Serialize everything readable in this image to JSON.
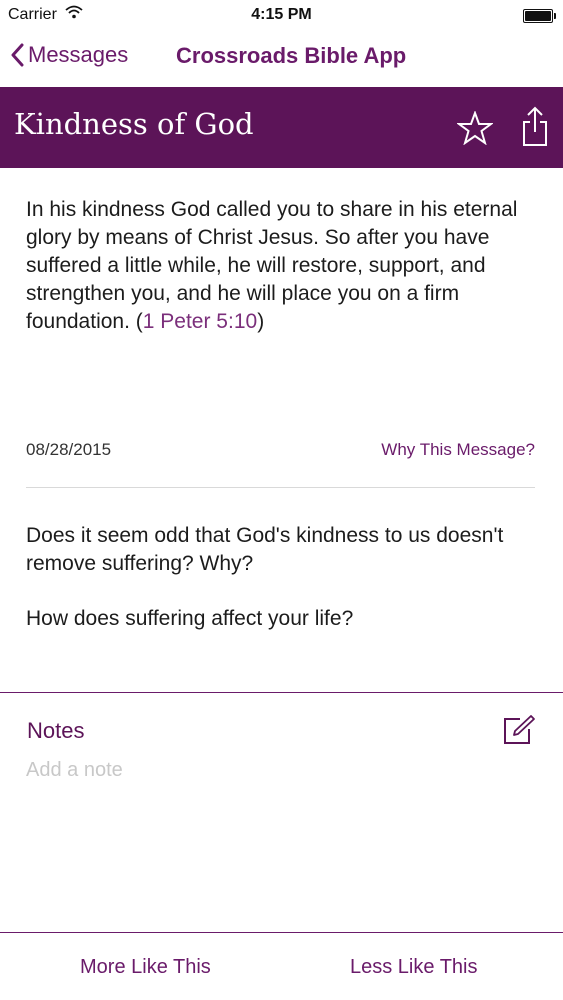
{
  "status_bar": {
    "carrier": "Carrier",
    "time": "4:15 PM"
  },
  "nav": {
    "back_label": "Messages",
    "title": "Crossroads Bible App"
  },
  "message": {
    "title": "Kindness of God",
    "verse_text": "In his kindness God called you to share in his eternal glory by means of Christ Jesus. So after you have suffered a little while, he will restore, support, and strengthen you, and he will place you on a firm foundation. (",
    "verse_ref": "1 Peter 5:10",
    "verse_close": ")",
    "date": "08/28/2015",
    "why_link": "Why This Message?"
  },
  "questions": [
    "Does it seem odd that God's kindness to us doesn't remove suffering? Why?",
    "How does suffering affect your life?"
  ],
  "notes": {
    "label": "Notes",
    "placeholder": "Add a note"
  },
  "bottom_actions": {
    "more_label": "More Like This",
    "less_label": "Less Like This"
  },
  "colors": {
    "accent": "#6a1b6a",
    "banner": "#5c1458"
  },
  "icons": [
    "wifi-icon",
    "battery-icon",
    "back-chevron-icon",
    "star-icon",
    "share-icon",
    "edit-note-icon"
  ]
}
